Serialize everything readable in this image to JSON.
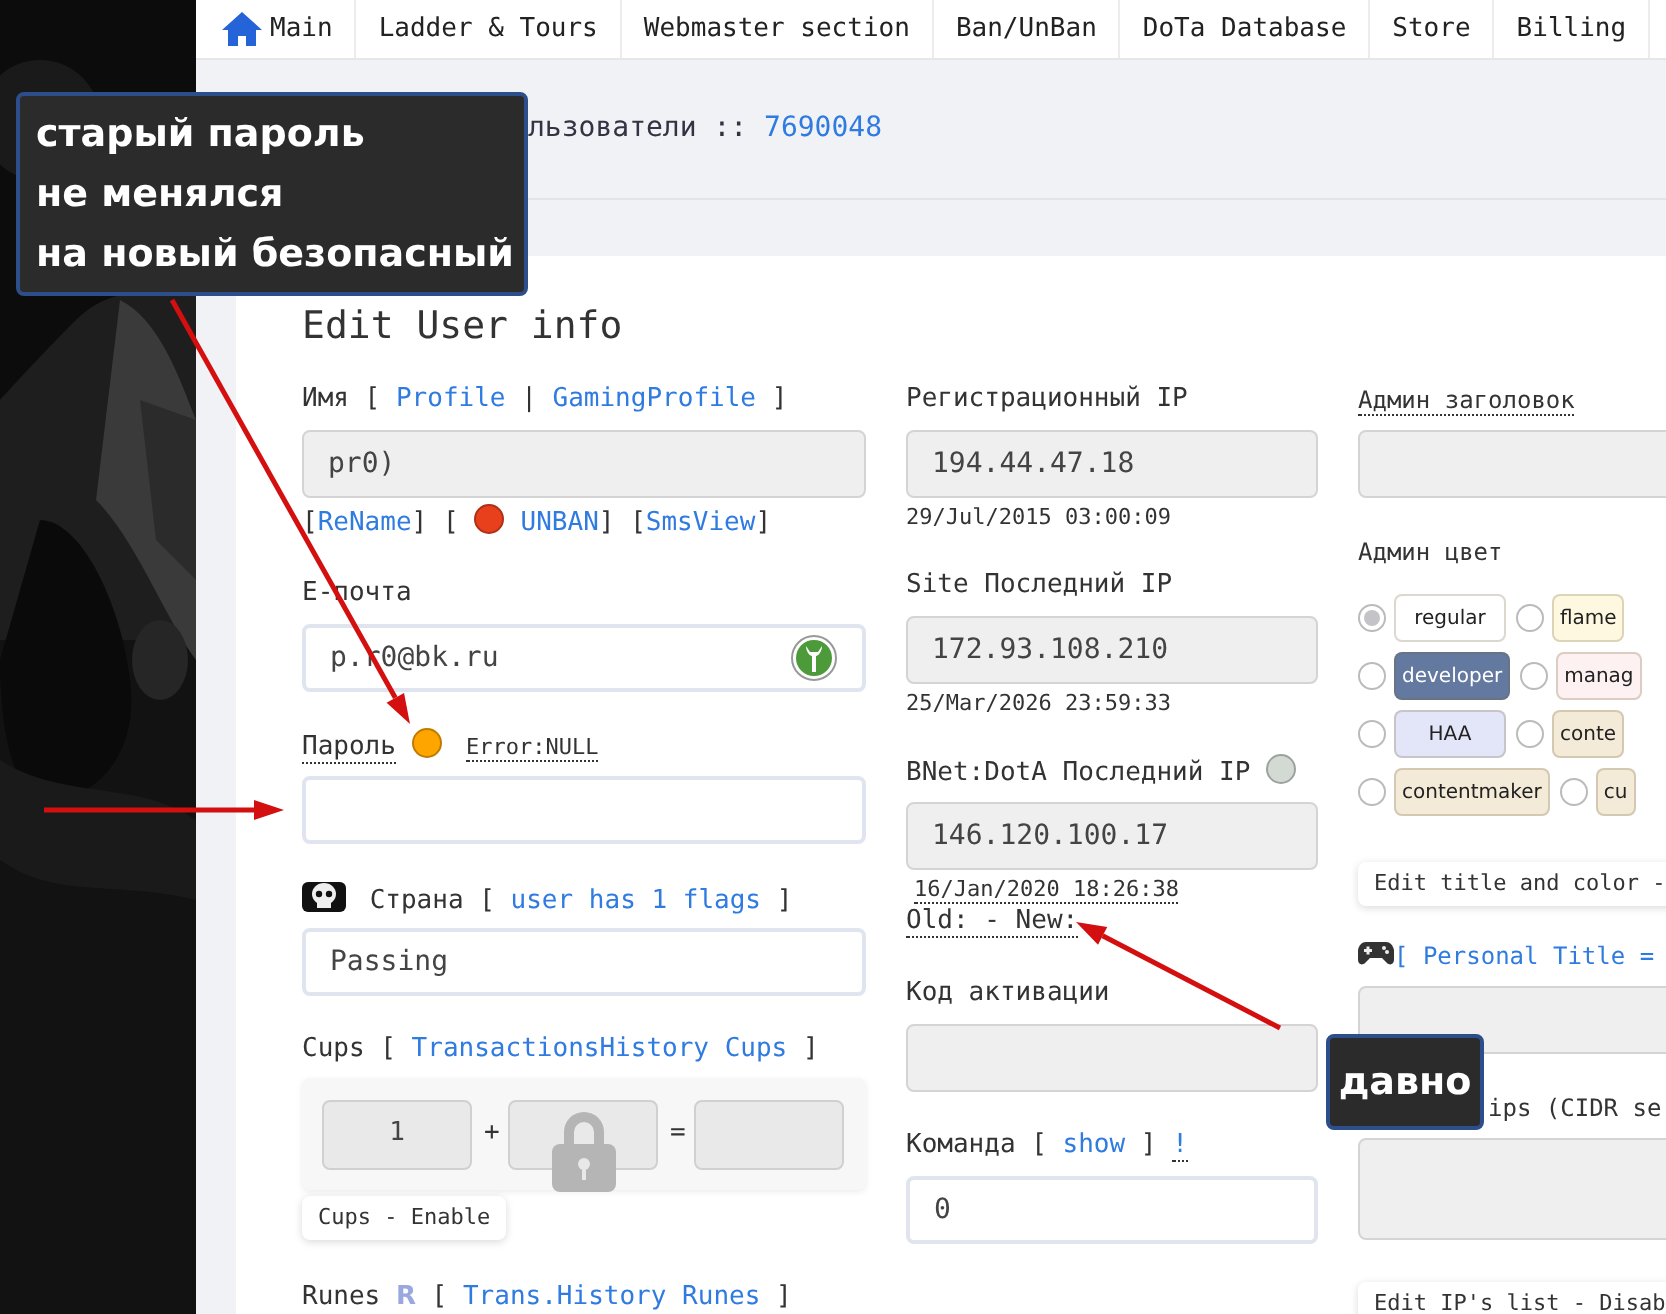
{
  "nav": [
    {
      "label": "Main",
      "kind": "home"
    },
    {
      "label": "Ladder & Tours",
      "kind": "plain"
    },
    {
      "label": "Webmaster section",
      "kind": "plain"
    },
    {
      "label": "Ban/UnBan",
      "kind": "plain"
    },
    {
      "label": "DoTa Database",
      "kind": "plain"
    },
    {
      "label": "Store",
      "kind": "plain"
    },
    {
      "label": "Billing",
      "kind": "plain"
    }
  ],
  "breadcrumb": {
    "text": "льзователи ::",
    "link": "7690048"
  },
  "heading": "Edit User info",
  "columns": [
    [
      {
        "kind": "field",
        "label": [
          {
            "kind": "text",
            "t": "Имя [ "
          },
          {
            "kind": "link",
            "t": "Profile"
          },
          {
            "kind": "text",
            "t": " | "
          },
          {
            "kind": "link",
            "t": "GamingProfile"
          },
          {
            "kind": "text",
            "t": " ]"
          }
        ],
        "input": {
          "value": "pr0)",
          "readonly": true
        },
        "below": [
          [
            {
              "kind": "text",
              "t": "["
            },
            {
              "kind": "link",
              "t": "ReName"
            },
            {
              "kind": "text",
              "t": "] ["
            },
            {
              "kind": "dot",
              "color": "#e8401c"
            },
            {
              "kind": "link",
              "t": "UNBAN"
            },
            {
              "kind": "text",
              "t": "] ["
            },
            {
              "kind": "link",
              "t": "SmsView"
            },
            {
              "kind": "text",
              "t": "]"
            }
          ]
        ]
      },
      {
        "kind": "field",
        "label": [
          {
            "kind": "text",
            "t": "E-почта"
          }
        ],
        "input": {
          "value": "p.r0@bk.ru",
          "readonly": false,
          "kind": "emblem"
        }
      },
      {
        "kind": "field",
        "label": [
          {
            "kind": "dotted",
            "t": "Пароль"
          },
          {
            "kind": "dot",
            "color": "#ffa500"
          },
          {
            "kind": "small-dotted",
            "t": "Error:NULL"
          }
        ],
        "input": {
          "readonly": false
        }
      },
      {
        "kind": "field",
        "label": [
          {
            "kind": "skull"
          },
          {
            "kind": "text",
            "t": " Страна [ "
          },
          {
            "kind": "link",
            "t": "user has 1 flags"
          },
          {
            "kind": "text",
            "t": " ]"
          }
        ],
        "input": {
          "value": "Passing",
          "readonly": false
        }
      },
      {
        "kind": "cups",
        "label": [
          {
            "kind": "text",
            "t": "Cups [ "
          },
          {
            "kind": "link",
            "t": "TransactionsHistory Cups"
          },
          {
            "kind": "text",
            "t": " ]"
          }
        ],
        "values": [
          "1"
        ],
        "operators": [
          "+",
          "="
        ],
        "locked": true,
        "tag": "Cups - Enable"
      },
      {
        "kind": "field",
        "label": [
          {
            "kind": "text",
            "t": "Runes "
          },
          {
            "kind": "rune",
            "t": "R"
          },
          {
            "kind": "text",
            "t": " [ "
          },
          {
            "kind": "link",
            "t": "Trans.History Runes"
          },
          {
            "kind": "text",
            "t": " ]"
          }
        ]
      }
    ],
    [
      {
        "kind": "field",
        "label": [
          {
            "kind": "text",
            "t": "Регистрационный IP"
          }
        ],
        "input": {
          "value": "194.44.47.18",
          "readonly": true
        },
        "below": [
          [
            {
              "kind": "small",
              "t": "29/Jul/2015 03:00:09"
            }
          ]
        ]
      },
      {
        "kind": "field",
        "label": [
          {
            "kind": "text",
            "t": "Site Последний IP"
          }
        ],
        "input": {
          "value": "172.93.108.210",
          "readonly": true
        },
        "below": [
          [
            {
              "kind": "small",
              "t": "25/Mar/2026 23:59:33"
            }
          ]
        ]
      },
      {
        "kind": "field",
        "label": [
          {
            "kind": "text",
            "t": "BNet:DotA Последний IP"
          },
          {
            "kind": "dot",
            "color": "#d3d9d3"
          }
        ],
        "input": {
          "value": "146.120.100.17",
          "readonly": true
        },
        "below": [
          [
            {
              "kind": "small-dotted",
              "t": "16/Jan/2020 18:26:38"
            }
          ],
          [
            {
              "kind": "dotted",
              "t": "Old: - New:"
            }
          ]
        ]
      },
      {
        "kind": "field",
        "label": [
          {
            "kind": "text",
            "t": "Код активации"
          }
        ],
        "input": {
          "readonly": true
        }
      },
      {
        "kind": "field",
        "label": [
          {
            "kind": "text",
            "t": "Команда [ "
          },
          {
            "kind": "link",
            "t": "show"
          },
          {
            "kind": "text",
            "t": " ] "
          },
          {
            "kind": "dotted-link",
            "t": "!"
          }
        ],
        "input": {
          "value": "0",
          "readonly": false
        }
      }
    ],
    [
      {
        "kind": "field",
        "label": [
          {
            "kind": "dotted",
            "t": "Админ заголовок"
          }
        ],
        "input": {
          "readonly": true
        }
      },
      {
        "kind": "colors",
        "label": [
          {
            "kind": "text",
            "t": "Админ цвет"
          }
        ],
        "rows": [
          [
            {
              "label": "regular",
              "color": "#ffffff",
              "selected": true
            },
            {
              "label": "flame",
              "color": "#fff8e1",
              "selected": false
            }
          ],
          [
            {
              "label": "developer",
              "color": "#64799f",
              "selected": false
            },
            {
              "label": "manag",
              "color": "#fdf1f1",
              "selected": false
            }
          ],
          [
            {
              "label": "HAA",
              "color": "#e3e5f8",
              "selected": false
            },
            {
              "label": "conte",
              "color": "#f3ead8",
              "selected": false
            }
          ],
          [
            {
              "label": "contentmaker",
              "color": "#f3ead8",
              "selected": false
            },
            {
              "label": "cu",
              "color": "#f3ead8",
              "selected": false
            }
          ]
        ]
      },
      {
        "kind": "tag",
        "text": "Edit title and color -"
      },
      {
        "kind": "field",
        "label": [
          {
            "kind": "gamepad"
          },
          {
            "kind": "link",
            "t": "[ Personal Title ="
          }
        ],
        "input": {
          "readonly": true
        }
      },
      {
        "kind": "field",
        "partly_hidden": true,
        "label": [
          {
            "kind": "text",
            "t": "ips (CIDR se"
          }
        ],
        "input": {
          "readonly": true,
          "multiline": true
        }
      },
      {
        "kind": "tag",
        "text": "Edit IP's list - Disab"
      }
    ]
  ],
  "callouts": [
    {
      "lines": [
        "старый пароль",
        "не менялся",
        "на новый безопасный"
      ]
    },
    {
      "lines": [
        "давно"
      ]
    }
  ]
}
